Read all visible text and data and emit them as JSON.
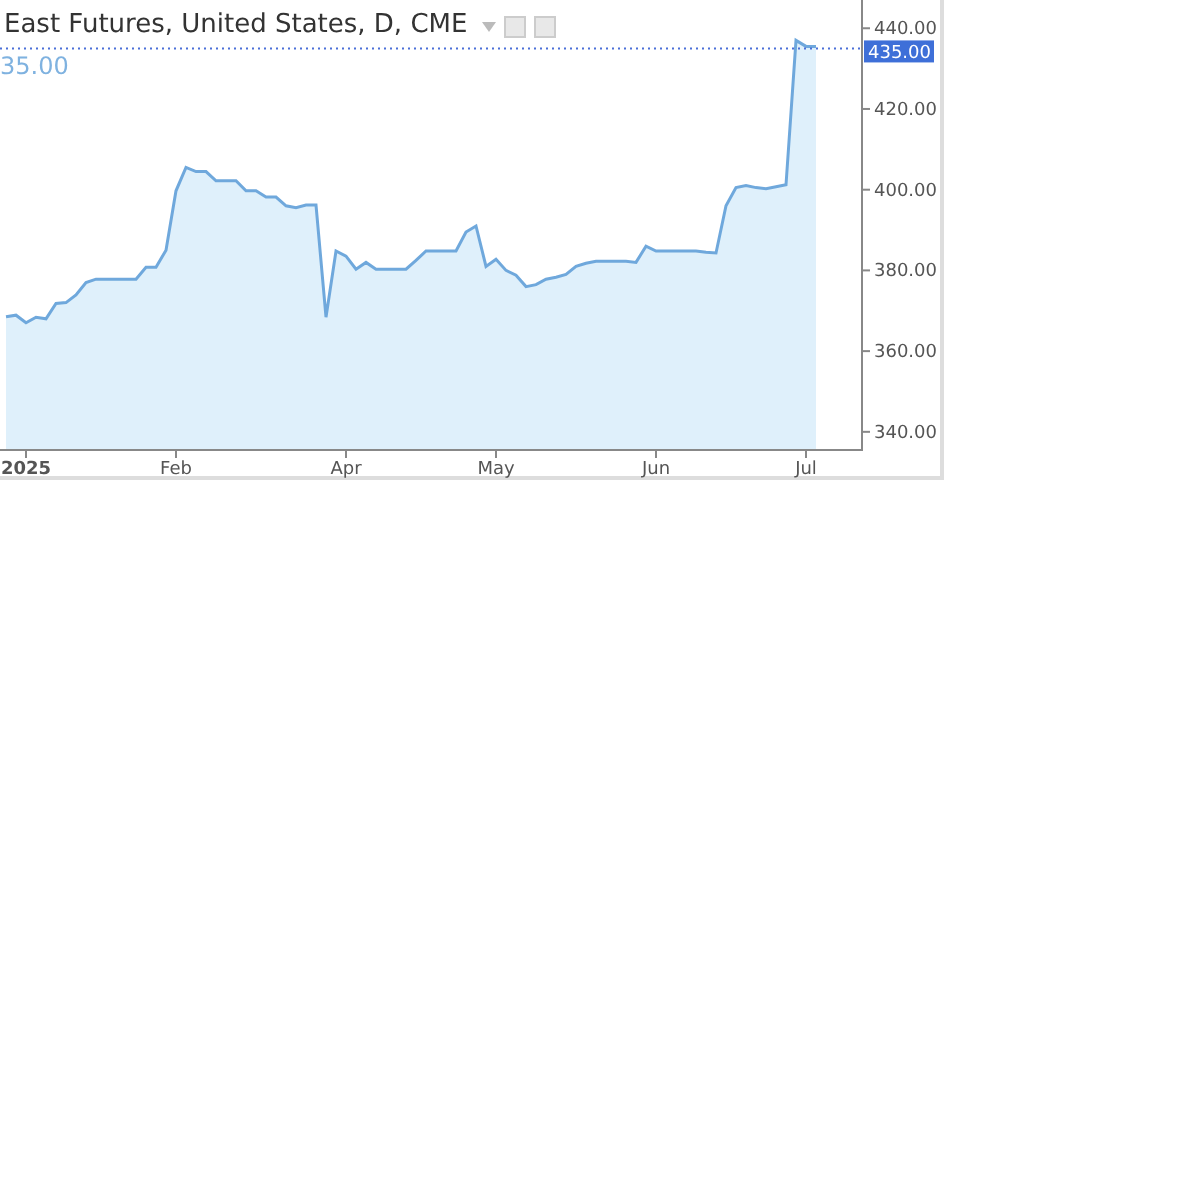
{
  "chart": {
    "title": "East Futures, United States, D, CME",
    "legend_value": "35.00",
    "chart_data": {
      "type": "area",
      "ylim": [
        335.5,
        447
      ],
      "categories": [
        null,
        null,
        "2025",
        null,
        null,
        null,
        null,
        null,
        null,
        null,
        null,
        null,
        null,
        null,
        null,
        null,
        null,
        "Feb",
        null,
        null,
        null,
        null,
        null,
        null,
        null,
        null,
        null,
        null,
        null,
        null,
        null,
        null,
        null,
        null,
        "Apr",
        null,
        null,
        null,
        null,
        null,
        null,
        null,
        null,
        null,
        null,
        null,
        null,
        null,
        null,
        "May",
        null,
        null,
        null,
        null,
        null,
        null,
        null,
        null,
        null,
        null,
        null,
        null,
        null,
        null,
        null,
        "Jun",
        null,
        null,
        null,
        null,
        null,
        null,
        null,
        null,
        null,
        null,
        null,
        null,
        null,
        null,
        "Jul",
        null
      ],
      "yticks": [
        {
          "value": 340,
          "label": "340.00"
        },
        {
          "value": 360,
          "label": "360.00"
        },
        {
          "value": 380,
          "label": "380.00"
        },
        {
          "value": 400,
          "label": "400.00"
        },
        {
          "value": 420,
          "label": "420.00"
        },
        {
          "value": 440,
          "label": "440.00"
        }
      ],
      "series": [
        {
          "color": "#6fa8dc",
          "values": [
            368.5,
            368.9,
            367,
            368.4,
            368,
            371.8,
            372,
            373.9,
            377,
            377.8,
            377.8,
            377.8,
            377.8,
            377.8,
            380.8,
            380.8,
            385,
            399.7,
            405.5,
            404.5,
            404.5,
            402.2,
            402.2,
            402.2,
            399.7,
            399.7,
            398.2,
            398.2,
            396,
            395.5,
            396.2,
            396.2,
            368.4,
            384.8,
            383.5,
            380.3,
            382,
            380.3,
            380.3,
            380.3,
            380.3,
            382.5,
            384.8,
            384.8,
            384.8,
            384.8,
            389.5,
            391,
            381,
            382.8,
            380,
            378.8,
            376,
            376.5,
            377.8,
            378.3,
            379,
            381,
            381.8,
            382.3,
            382.3,
            382.3,
            382.3,
            382,
            386,
            384.8,
            384.8,
            384.8,
            384.8,
            384.8,
            384.5,
            384.3,
            396,
            400.5,
            401,
            400.5,
            400.2,
            400.7,
            401.2,
            437,
            435.5,
            435.5
          ]
        }
      ],
      "ref_lines": [
        {
          "axis": "y",
          "value": 435,
          "label": "435.00"
        }
      ]
    }
  }
}
